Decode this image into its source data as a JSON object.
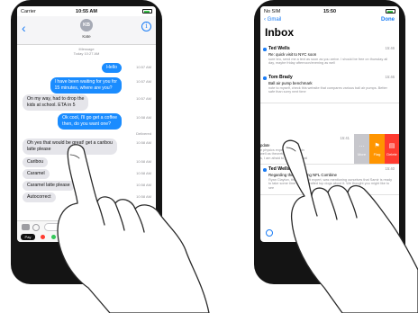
{
  "messages_app": {
    "status_bar": {
      "carrier": "Carrier",
      "time": "10:55 AM"
    },
    "header": {
      "avatar_initials": "KB",
      "contact_name": "Kate"
    },
    "meta": {
      "service": "iMessage",
      "date": "Today 10:27 AM"
    },
    "conversation": [
      {
        "direction": "out",
        "text": "Hello",
        "time": "10:57 AM"
      },
      {
        "direction": "out",
        "text_lines": [
          "I have been waiting for you for",
          "15 minutes, where are you?"
        ],
        "time": "10:57 AM"
      },
      {
        "direction": "in",
        "text_lines": [
          "On my way, had to drop the",
          "kids at school. ETA in 5"
        ],
        "time": "10:57 AM"
      },
      {
        "direction": "out",
        "text_lines": [
          "Ok cool, I'll go get a coffee",
          "then, do you want one?"
        ],
        "time": "10:58 AM"
      },
      {
        "direction": "status",
        "text": "Delivered"
      },
      {
        "direction": "in",
        "text_lines": [
          "Oh yes that would be great! get a caribou",
          "latte please"
        ],
        "time": "10:58 AM"
      },
      {
        "direction": "in",
        "text": "Caribou",
        "time": "10:58 AM"
      },
      {
        "direction": "in",
        "text": "Caramel",
        "time": "10:58 AM"
      },
      {
        "direction": "in",
        "text": "Caramel latte please",
        "time": "10:58 AM"
      },
      {
        "direction": "in",
        "text": "Autocorrect",
        "time": "10:58 AM"
      }
    ],
    "compose": {
      "pay_label": "Pay"
    }
  },
  "mail_app": {
    "status_bar": {
      "carrier": "No SIM",
      "time": "15:50"
    },
    "nav": {
      "back_label": "Gmail",
      "done_label": "Done"
    },
    "title": "Inbox",
    "emails": [
      {
        "sender": "Ted Wells",
        "time": "15:46",
        "subject": "Re: quick visit to NYC soon",
        "preview": "sure bro, send me a text as soon as you arrive. I should be free on thursday all day, maybe friday afternoon/evening as well"
      },
      {
        "sender": "Tom Brady",
        "time": "15:46",
        "subject": "Ball air pump benchmark",
        "preview": "note to myself, check this website that compares various ball air pumps. Better safe than sorry next time"
      },
      {
        "sender": "",
        "time": "15:41",
        "subject": "",
        "preview": ""
      },
      {
        "sender": "Ted Wells",
        "time": "15:40",
        "subject": "Regarding the upcoming NFL Combine",
        "preview": "Ryan Clayton, the NFL draft expert, was mentioning ourselves that Samir is ready to take some time off, we drafted top dogs about it. We thought you might like to see"
      }
    ],
    "swiped_email_partial": {
      "subject_fragment": "pdate",
      "preview_lines": [
        "e physics experiment explain",
        "well as theoretical facts",
        "s, I am afraid to pump your ball"
      ]
    },
    "swipe_actions": [
      {
        "label": "More",
        "icon": "…",
        "color": "#c7c7cc"
      },
      {
        "label": "Flag",
        "icon": "⚑",
        "color": "#ff9500"
      },
      {
        "label": "Delete",
        "icon": "▤",
        "color": "#ff3b30"
      }
    ]
  }
}
